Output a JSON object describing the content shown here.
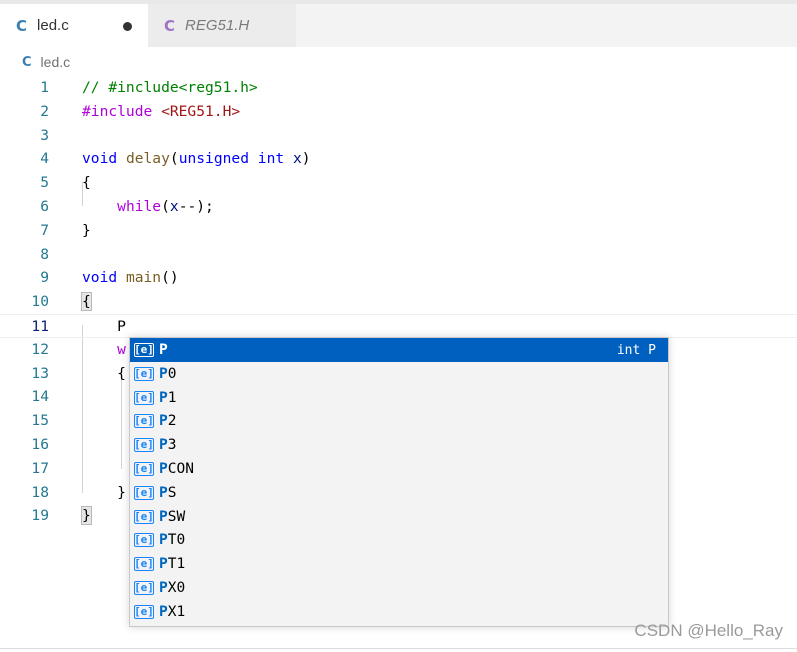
{
  "tabs": [
    {
      "icon": "C",
      "label": "led.c",
      "active": true,
      "dirty": true
    },
    {
      "icon": "C",
      "label": "REG51.H",
      "active": false,
      "dirty": false
    }
  ],
  "breadcrumb": {
    "icon": "C",
    "label": "led.c"
  },
  "editor": {
    "current_line": 11,
    "lines": [
      {
        "n": "1",
        "tokens": [
          {
            "t": "// #include<reg51.h>",
            "c": "comment"
          }
        ]
      },
      {
        "n": "2",
        "tokens": [
          {
            "t": "#include ",
            "c": "directive"
          },
          {
            "t": "<REG51.H>",
            "c": "string"
          }
        ]
      },
      {
        "n": "3",
        "tokens": []
      },
      {
        "n": "4",
        "tokens": [
          {
            "t": "void",
            "c": "keyword"
          },
          {
            "t": " ",
            "c": "plain"
          },
          {
            "t": "delay",
            "c": "func"
          },
          {
            "t": "(",
            "c": "plain"
          },
          {
            "t": "unsigned",
            "c": "keyword"
          },
          {
            "t": " ",
            "c": "plain"
          },
          {
            "t": "int",
            "c": "keyword"
          },
          {
            "t": " ",
            "c": "plain"
          },
          {
            "t": "x",
            "c": "var"
          },
          {
            "t": ")",
            "c": "plain"
          }
        ]
      },
      {
        "n": "5",
        "tokens": [
          {
            "t": "{",
            "c": "plain"
          }
        ]
      },
      {
        "n": "6",
        "tokens": [
          {
            "t": "    ",
            "c": "plain"
          },
          {
            "t": "while",
            "c": "control"
          },
          {
            "t": "(",
            "c": "plain"
          },
          {
            "t": "x",
            "c": "var"
          },
          {
            "t": "--);",
            "c": "plain"
          }
        ]
      },
      {
        "n": "7",
        "tokens": [
          {
            "t": "}",
            "c": "plain"
          }
        ]
      },
      {
        "n": "8",
        "tokens": []
      },
      {
        "n": "9",
        "tokens": [
          {
            "t": "void",
            "c": "keyword"
          },
          {
            "t": " ",
            "c": "plain"
          },
          {
            "t": "main",
            "c": "func"
          },
          {
            "t": "()",
            "c": "plain"
          }
        ]
      },
      {
        "n": "10",
        "tokens": [
          {
            "t": "{",
            "c": "brace-match"
          }
        ]
      },
      {
        "n": "11",
        "tokens": [
          {
            "t": "    P",
            "c": "plain"
          }
        ]
      },
      {
        "n": "12",
        "tokens": [
          {
            "t": "    ",
            "c": "plain"
          },
          {
            "t": "w",
            "c": "control"
          }
        ]
      },
      {
        "n": "13",
        "tokens": [
          {
            "t": "    {",
            "c": "plain"
          }
        ]
      },
      {
        "n": "14",
        "tokens": []
      },
      {
        "n": "15",
        "tokens": []
      },
      {
        "n": "16",
        "tokens": []
      },
      {
        "n": "17",
        "tokens": []
      },
      {
        "n": "18",
        "tokens": [
          {
            "t": "    }",
            "c": "plain"
          }
        ]
      },
      {
        "n": "19",
        "tokens": [
          {
            "t": "}",
            "c": "brace-match"
          }
        ]
      }
    ]
  },
  "suggestions": {
    "typed": "P",
    "icon": "[e]",
    "icon_name": "variable-icon",
    "items": [
      {
        "label": "P",
        "detail": "int P",
        "selected": true
      },
      {
        "label": "P0",
        "detail": "",
        "selected": false
      },
      {
        "label": "P1",
        "detail": "",
        "selected": false
      },
      {
        "label": "P2",
        "detail": "",
        "selected": false
      },
      {
        "label": "P3",
        "detail": "",
        "selected": false
      },
      {
        "label": "PCON",
        "detail": "",
        "selected": false
      },
      {
        "label": "PS",
        "detail": "",
        "selected": false
      },
      {
        "label": "PSW",
        "detail": "",
        "selected": false
      },
      {
        "label": "PT0",
        "detail": "",
        "selected": false
      },
      {
        "label": "PT1",
        "detail": "",
        "selected": false
      },
      {
        "label": "PX0",
        "detail": "",
        "selected": false
      },
      {
        "label": "PX1",
        "detail": "",
        "selected": false
      }
    ]
  },
  "watermark": "CSDN @Hello_Ray",
  "colors": {
    "selection": "#0060c0",
    "line_number": "#237893",
    "keyword": "#0000ff",
    "control": "#af00db",
    "function": "#795e26",
    "comment": "#008000",
    "string": "#a31515"
  }
}
